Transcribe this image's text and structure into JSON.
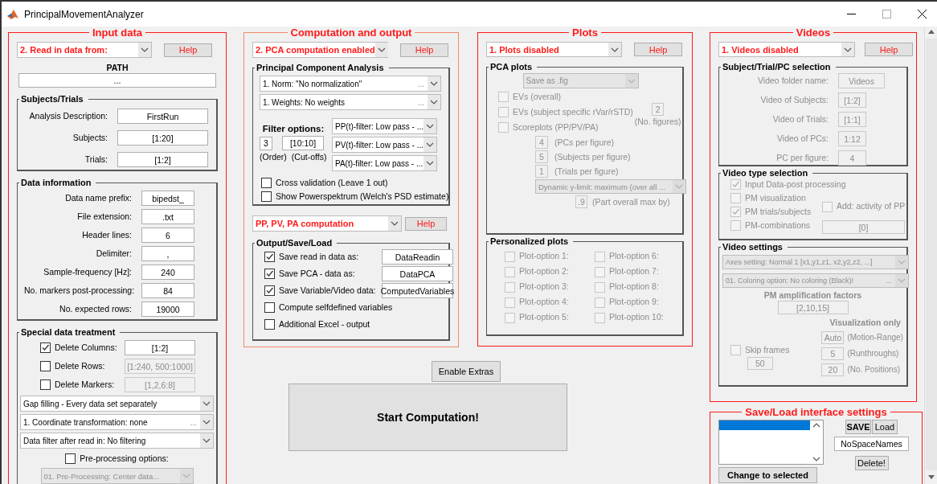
{
  "window": {
    "title": "PrincipalMovementAnalyzer"
  },
  "input_data": {
    "title": "Input data",
    "mode": "2. Read in data from:",
    "help": "Help",
    "path_label": "PATH",
    "path": "...",
    "subjects_trials": {
      "title": "Subjects/Trials",
      "fields": [
        {
          "label": "Analysis Description:",
          "value": "FirstRun"
        },
        {
          "label": "Subjects:",
          "value": "[1:20]"
        },
        {
          "label": "Trials:",
          "value": "[1:2]"
        }
      ]
    },
    "data_information": {
      "title": "Data information",
      "fields": [
        {
          "label": "Data name prefix:",
          "value": "bipedst_"
        },
        {
          "label": "File extension:",
          "value": ".txt"
        },
        {
          "label": "Header lines:",
          "value": "6"
        },
        {
          "label": "Delimiter:",
          "value": ","
        },
        {
          "label": "Sample-frequency [Hz]:",
          "value": "240"
        },
        {
          "label": "No. markers post-processing:",
          "value": "84"
        },
        {
          "label": "No. expected rows:",
          "value": "19000"
        }
      ]
    },
    "special_treatment": {
      "title": "Special data treatment",
      "options": [
        {
          "label": "Delete Columns:",
          "checked": true,
          "value": "[1:2]"
        },
        {
          "label": "Delete Rows:",
          "checked": false,
          "value": "[1:240, 500:1000]"
        },
        {
          "label": "Delete Markers:",
          "checked": false,
          "value": "[1,2,6:8]"
        }
      ],
      "dropdowns": [
        {
          "text": "Gap filling - Every data set separately"
        },
        {
          "text": "1.   Coordinate transformation: none",
          "more": "..."
        },
        {
          "text": "Data filter after read in: No filtering"
        }
      ],
      "preprocessing": {
        "label": "Pre-processing options:",
        "checked": false,
        "select": "01. Pre-Processing: Center data..."
      }
    }
  },
  "computation": {
    "title": "Computation and output",
    "mode": "2. PCA computation enabled",
    "help": "Help",
    "pca": {
      "title": "Principal Component Analysis",
      "dropdowns": [
        {
          "text": "1.   Norm: \"No normalization\"",
          "more": "..."
        },
        {
          "text": "1.   Weights: No weights",
          "more": "..."
        }
      ],
      "filter": {
        "title": "Filter options:",
        "order": "3",
        "cutoffs": "[10:10]",
        "order_label": "(Order)",
        "cutoffs_label": "(Cut-offs)",
        "dropdowns": [
          "PP(t)-filter: Low pass - ...",
          "PV(t)-filter: Low pass - ...",
          "PA(t)-filter: Low pass - ..."
        ]
      },
      "options": [
        {
          "label": "Cross validation (Leave 1 out)",
          "checked": false
        },
        {
          "label": "Show Powerspektrum (Welch's PSD estimate)",
          "checked": false
        }
      ]
    },
    "pp_mode": "PP, PV, PA  computation",
    "pp_help": "Help",
    "output": {
      "title": "Output/Save/Load",
      "options": [
        {
          "label": "Save read in data as:",
          "checked": true,
          "value": "DataReadin"
        },
        {
          "label": "Save PCA - data as:",
          "checked": true,
          "value": "DataPCA"
        },
        {
          "label": "Save Variable/Video data:",
          "checked": true,
          "value": "ComputedVariables"
        },
        {
          "label": "Compute selfdefined variables",
          "checked": false
        },
        {
          "label": "Additional Excel - output",
          "checked": false
        }
      ]
    }
  },
  "enable_extras": "Enable Extras",
  "start": "Start Computation!",
  "plots": {
    "title": "Plots",
    "mode": "1. Plots disabled",
    "help": "Help",
    "pca_plots": {
      "title": "PCA plots",
      "disabled": true,
      "save_as": "Save as .fig",
      "options": [
        {
          "label": "EVs (overall)",
          "checked": false
        },
        {
          "label": "EVs (subject specific rVar/rSTD)",
          "checked": false
        },
        {
          "label": "Scoreplots (PP/PV/PA)",
          "checked": false
        }
      ],
      "figures": {
        "value": "2",
        "label": "(No. figures)"
      },
      "params": [
        {
          "value": "4",
          "label": "(PCs per figure)"
        },
        {
          "value": "5",
          "label": "(Subjects per figure)"
        },
        {
          "value": "1",
          "label": "(Trials per figure)"
        }
      ],
      "ylimit": "Dynamic y-limit: maximum (over all ...",
      "part": {
        "value": ".9",
        "label": "(Part overall max by)"
      }
    },
    "personalized": {
      "title": "Personalized plots",
      "disabled": true,
      "options": [
        {
          "label": "Plot-option 1:",
          "checked": false
        },
        {
          "label": "Plot-option 2:",
          "checked": false
        },
        {
          "label": "Plot-option 3:",
          "checked": false
        },
        {
          "label": "Plot-option 4:",
          "checked": false
        },
        {
          "label": "Plot-option 5:",
          "checked": false
        },
        {
          "label": "Plot-option 6:",
          "checked": false
        },
        {
          "label": "Plot-option 7:",
          "checked": false
        },
        {
          "label": "Plot-option 8:",
          "checked": false
        },
        {
          "label": "Plot-option 9:",
          "checked": false
        },
        {
          "label": "Plot-option 10:",
          "checked": false
        }
      ]
    }
  },
  "videos": {
    "title": "Videos",
    "mode": "1. Videos disabled",
    "help": "Help",
    "selection": {
      "title": "Subject/Trial/PC selection",
      "disabled": true,
      "fields": [
        {
          "label": "Video folder name:",
          "value": "Videos"
        },
        {
          "label": "Video of Subjects:",
          "value": "[1:2]"
        },
        {
          "label": "Video of Trials:",
          "value": "[1:1]"
        },
        {
          "label": "Video of PCs:",
          "value": "1:12"
        },
        {
          "label": "PC per figure:",
          "value": "4"
        }
      ]
    },
    "video_type": {
      "title": "Video type selection",
      "disabled": true,
      "options": [
        {
          "label": "Input Data-post processing",
          "checked": true
        },
        {
          "label": "PM visualization",
          "checked": false
        },
        {
          "label": "PM trials/subjects",
          "checked": true
        },
        {
          "label": "PM-combinations",
          "checked": false
        }
      ],
      "activity": {
        "label": "Add: activity of PP",
        "checked": false
      },
      "combinations": "[0]"
    },
    "settings": {
      "title": "Video settings",
      "disabled": true,
      "dropdowns": [
        {
          "text": "Axes setting: Normal 1 [x1,y1,z1,  x2,y2,z2, ...]"
        },
        {
          "text": "01. Coloring option: No coloring (Black)!",
          "more": "..."
        }
      ],
      "amplification_label": "PM amplification factors",
      "amplification": "[2,10,15]",
      "visualization_label": "Visualization only",
      "skip": {
        "label": "Skip frames",
        "checked": false,
        "value": "50"
      },
      "params": [
        {
          "value": "Auto",
          "label": "(Motion-Range)"
        },
        {
          "value": "5",
          "label": "(Runthroughs)"
        },
        {
          "value": "20",
          "label": "(No. Positions)"
        }
      ]
    }
  },
  "save_load": {
    "title": "Save/Load interface settings",
    "list": [
      {
        "selected": true
      }
    ],
    "save": "SAVE",
    "load": "Load",
    "name": "NoSpaceNames",
    "change": "Change to selected",
    "delete": "Delete!"
  }
}
